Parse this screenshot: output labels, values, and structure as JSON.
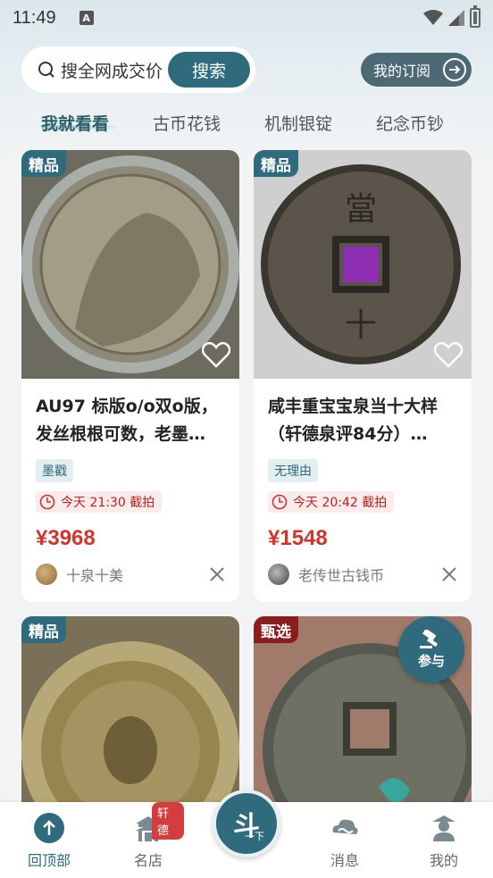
{
  "status_bar": {
    "time": "11:49",
    "a_icon": "A"
  },
  "search": {
    "placeholder": "搜全网成交价",
    "button": "搜索"
  },
  "subscribe": {
    "label": "我的订阅"
  },
  "tabs": [
    {
      "label": "我就看看",
      "active": true
    },
    {
      "label": "古币花钱"
    },
    {
      "label": "机制银锭"
    },
    {
      "label": "纪念币钞"
    }
  ],
  "cards": [
    {
      "badge": "精品",
      "title": "AU97 标版o/o双o版，发丝根根可数，老墨…",
      "tag": "墨戳",
      "auction": "今天 21:30 截拍",
      "price": "¥3968",
      "seller": "十泉十美"
    },
    {
      "badge": "精品",
      "title": "咸丰重宝宝泉当十大样（轩德泉评84分）…",
      "tag": "无理由",
      "auction": "今天 20:42 截拍",
      "price": "¥1548",
      "seller": "老传世古钱币"
    },
    {
      "badge": "精品"
    },
    {
      "badge": "甄选"
    }
  ],
  "join_button": {
    "label": "参与"
  },
  "bottom_nav": {
    "items": [
      {
        "label": "回顶部"
      },
      {
        "label": "名店",
        "badge": "轩德"
      },
      {
        "label": "消息"
      },
      {
        "label": "我的"
      }
    ],
    "center": {
      "big": "斗",
      "small": "一下"
    }
  },
  "colors": {
    "primary": "#2f6b7c",
    "price": "#d2352c",
    "badge_red": "#8a1e1e"
  }
}
